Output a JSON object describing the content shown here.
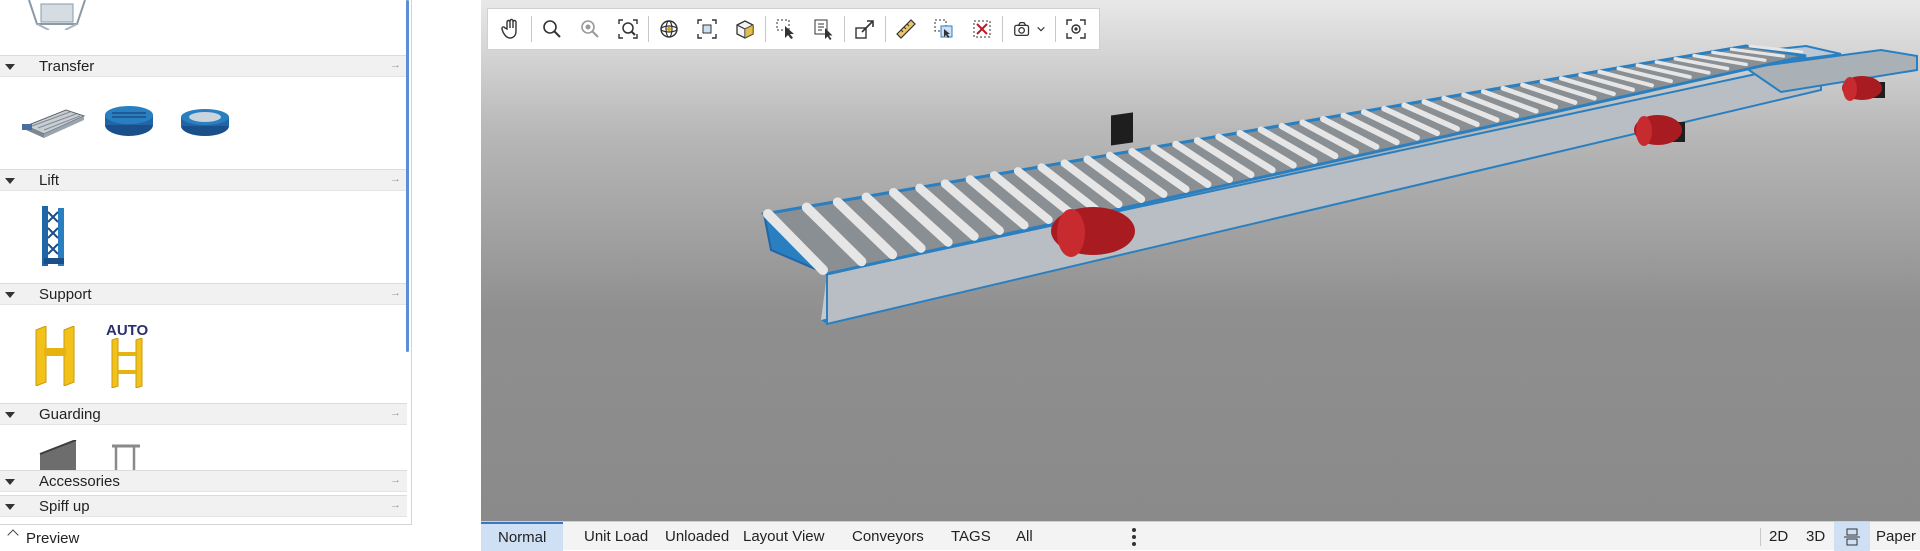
{
  "catalog": {
    "categories": [
      {
        "label": "Transfer",
        "icons": [
          "roller-transfer-icon",
          "turntable-icon",
          "round-turntable-icon"
        ]
      },
      {
        "label": "Lift",
        "icons": [
          "vertical-lift-icon"
        ]
      },
      {
        "label": "Support",
        "icons": [
          "h-support-icon",
          "auto-support-icon"
        ],
        "auto_badge": "AUTO"
      },
      {
        "label": "Guarding",
        "icons": [
          "guard-panel-icon",
          "guard-rail-icon"
        ]
      },
      {
        "label": "Accessories",
        "icons": []
      },
      {
        "label": "Spiff up",
        "icons": []
      }
    ],
    "preview_label": "Preview"
  },
  "toolbar": {
    "tools": [
      "pan-hand-icon",
      "zoom-icon",
      "zoom-window-icon",
      "zoom-extents-icon",
      "orbit-icon",
      "fit-selection-icon",
      "view-cube-icon",
      "select-icon",
      "select-list-icon",
      "move-icon",
      "measure-icon",
      "copy-selection-icon",
      "delete-selection-icon",
      "camera-icon",
      "focus-icon"
    ]
  },
  "bottom": {
    "tabs": [
      "Normal",
      "Unit Load",
      "Unloaded",
      "Layout View",
      "Conveyors",
      "TAGS",
      "All"
    ],
    "active_tab": "Normal",
    "modes": {
      "two_d": "2D",
      "three_d": "3D",
      "paper": "Paper"
    }
  },
  "colors": {
    "accent": "#3b78c4",
    "conveyor_frame": "#2a7fc0",
    "roller": "#e6e6e6",
    "motor": "#b81f24",
    "support_yellow": "#f2c21b"
  }
}
